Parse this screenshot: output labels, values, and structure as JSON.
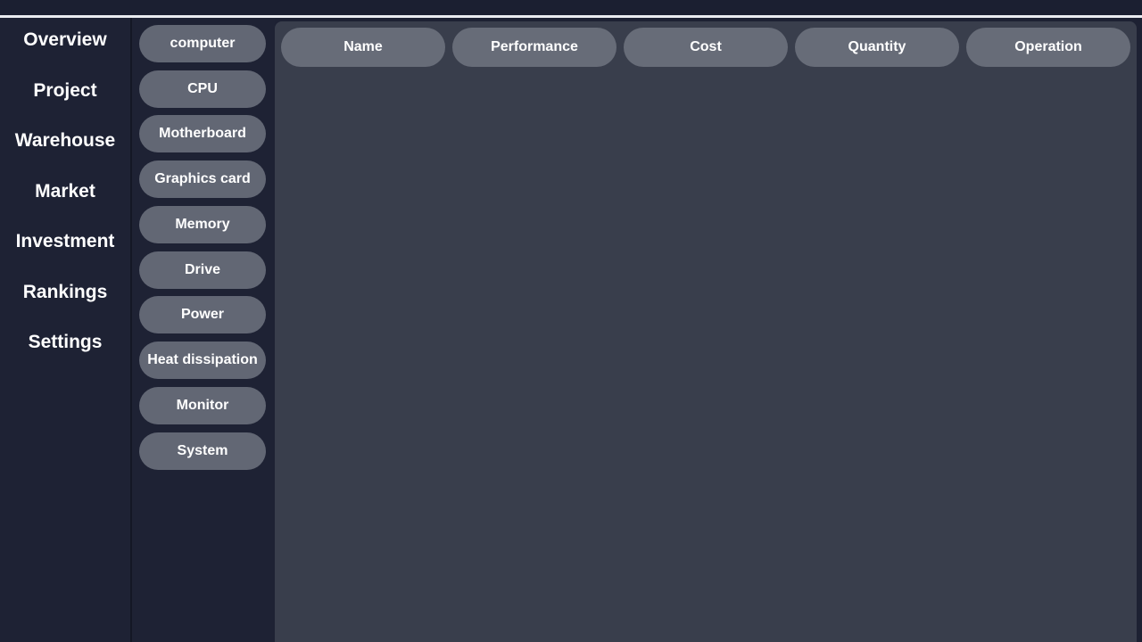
{
  "nav": {
    "items": [
      "Overview",
      "Project",
      "Warehouse",
      "Market",
      "Investment",
      "Rankings",
      "Settings"
    ]
  },
  "categories": {
    "items": [
      "computer",
      "CPU",
      "Motherboard",
      "Graphics card",
      "Memory",
      "Drive",
      "Power",
      "Heat dissipation",
      "Monitor",
      "System"
    ]
  },
  "table": {
    "columns": [
      "Name",
      "Performance",
      "Cost",
      "Quantity",
      "Operation"
    ],
    "rows": []
  },
  "colors": {
    "background": "#1d2133",
    "panel": "#393e4c",
    "button": "#626774",
    "text": "#ffffff"
  }
}
